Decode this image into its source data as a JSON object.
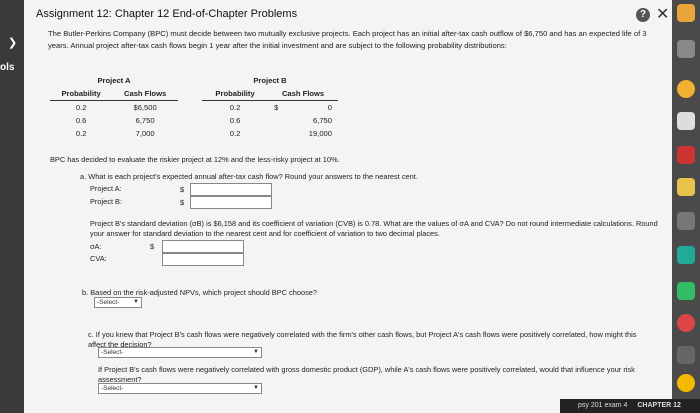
{
  "sidebar": {
    "ols": "ols",
    "chev": "❯"
  },
  "header": {
    "title": "Assignment 12: Chapter 12 End-of-Chapter Problems",
    "help": "?",
    "close": "✕"
  },
  "intro": "The Butler-Perkins Company (BPC) must decide between two mutually exclusive projects. Each project has an initial after-tax cash outflow of $6,750 and has an expected life of 3 years. Annual project after-tax cash flows begin 1 year after the initial investment and are subject to the following probability distributions:",
  "project_a": {
    "title": "Project A",
    "col1": "Probability",
    "col2": "Cash Flows",
    "rows": [
      [
        "0.2",
        "$6,500"
      ],
      [
        "0.6",
        "6,750"
      ],
      [
        "0.2",
        "7,000"
      ]
    ]
  },
  "project_b": {
    "title": "Project B",
    "col1": "Probability",
    "col2": "Cash Flows",
    "rows": [
      [
        "0.2",
        "$",
        "0"
      ],
      [
        "0.6",
        "",
        "6,750"
      ],
      [
        "0.2",
        "",
        "19,000"
      ]
    ]
  },
  "discount_text": "BPC has decided to evaluate the riskier project at 12% and the less-risky project at 10%.",
  "qa": {
    "question": "a. What is each project's expected annual after-tax cash flow? Round your answers to the nearest cent.",
    "label_a": "Project A:",
    "label_b": "Project B:",
    "dollar": "$"
  },
  "std": {
    "text": "Project B's standard deviation (σB) is $6,158 and its coefficient of variation (CVB) is 0.78. What are the values of σA and CVA? Do not round intermediate calculations. Round your answer for standard deviation to the nearest cent and for coefficient of variation to two decimal places.",
    "sigma_label": "σA:",
    "cv_label": "CVA:",
    "dollar": "$"
  },
  "qb": {
    "question": "b. Based on the risk-adjusted NPVs, which project should BPC choose?",
    "select": "-Select-"
  },
  "qc": {
    "question": "c. If you knew that Project B's cash flows were negatively correlated with the firm's other cash flows, but Project A's cash flows were positively correlated, how might this affect the decision?",
    "select": "-Select-"
  },
  "qd": {
    "question": "If Project B's cash flows were negatively correlated with gross domestic product (GDP), while A's cash flows were positively correlated, would that influence your risk assessment?",
    "select": "-Select-"
  },
  "taskbar": {
    "item1": "psy 201 exam 4",
    "item2": "CHAPTER 12"
  }
}
